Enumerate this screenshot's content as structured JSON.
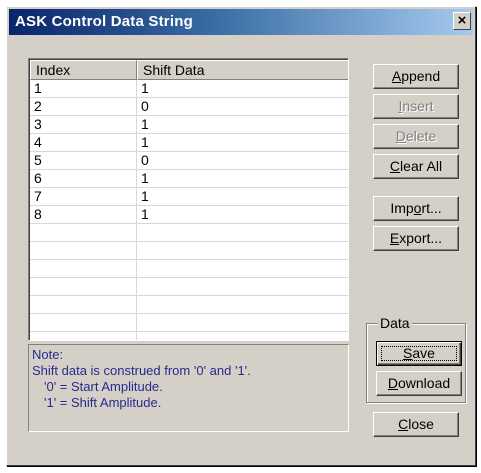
{
  "window": {
    "title": "ASK Control Data String",
    "close_glyph": "×"
  },
  "table": {
    "columns": [
      "Index",
      "Shift Data"
    ],
    "rows": [
      [
        "1",
        "1"
      ],
      [
        "2",
        "0"
      ],
      [
        "3",
        "1"
      ],
      [
        "4",
        "1"
      ],
      [
        "5",
        "0"
      ],
      [
        "6",
        "1"
      ],
      [
        "7",
        "1"
      ],
      [
        "8",
        "1"
      ],
      [
        "",
        ""
      ],
      [
        "",
        ""
      ],
      [
        "",
        ""
      ],
      [
        "",
        ""
      ],
      [
        "",
        ""
      ],
      [
        "",
        ""
      ]
    ]
  },
  "note": {
    "title": "Note:",
    "line1": "Shift data is construed from '0' and '1'.",
    "line2": "'0' = Start Amplitude.",
    "line3": "'1' = Shift Amplitude."
  },
  "buttons": {
    "append": {
      "mn": "A",
      "rest": "ppend"
    },
    "insert": {
      "mn": "I",
      "rest": "nsert"
    },
    "delete": {
      "mn": "D",
      "rest": "elete"
    },
    "clear_all": {
      "mn": "C",
      "rest": "lear All"
    },
    "import": {
      "pre": "Imp",
      "mn": "o",
      "rest": "rt..."
    },
    "export": {
      "mn": "E",
      "rest": "xport..."
    },
    "save": {
      "mn": "S",
      "rest": "ave"
    },
    "download": {
      "mn": "D",
      "rest": "ownload"
    },
    "close": {
      "mn": "C",
      "rest": "lose"
    }
  },
  "data_group": {
    "label": "Data"
  }
}
